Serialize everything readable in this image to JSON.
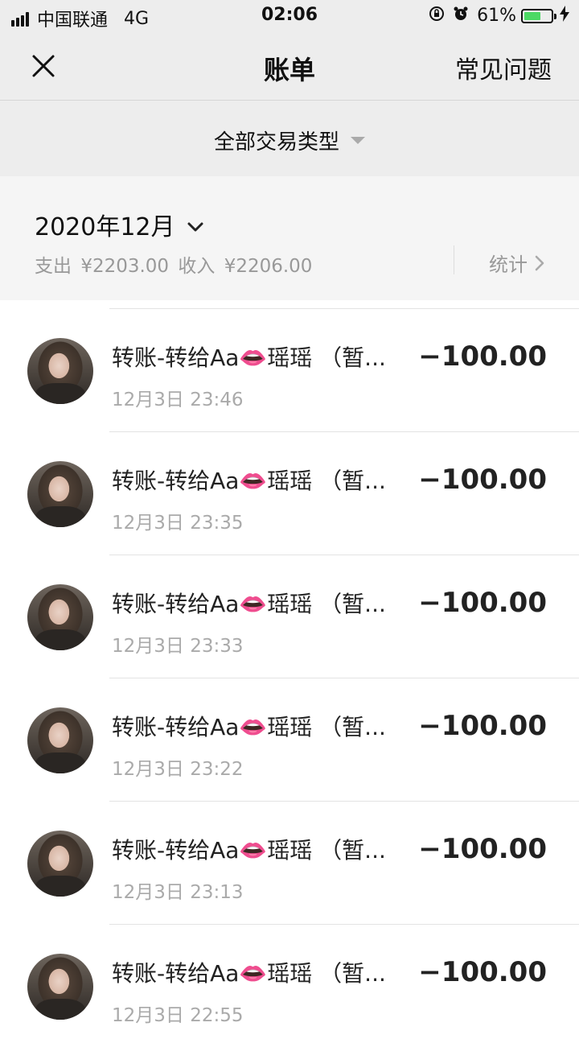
{
  "status_bar": {
    "carrier": "中国联通",
    "network": "4G",
    "time": "02:06",
    "battery": "61%",
    "battery_level": 0.61,
    "battery_color": "#4cd964"
  },
  "header": {
    "title": "账单",
    "faq_label": "常见问题",
    "close_icon": "close-icon"
  },
  "filter": {
    "label": "全部交易类型"
  },
  "summary": {
    "month": "2020年12月",
    "expense_label": "支出",
    "expense": "¥2203.00",
    "income_label": "收入",
    "income": "¥2206.00",
    "stats_label": "统计"
  },
  "transactions": [
    {
      "title": "转账-转给Aa👄瑶瑶 （暂...",
      "time": "12月3日 23:46",
      "amount": "−100.00"
    },
    {
      "title": "转账-转给Aa👄瑶瑶 （暂...",
      "time": "12月3日 23:35",
      "amount": "−100.00"
    },
    {
      "title": "转账-转给Aa👄瑶瑶 （暂...",
      "time": "12月3日 23:33",
      "amount": "−100.00"
    },
    {
      "title": "转账-转给Aa👄瑶瑶 （暂...",
      "time": "12月3日 23:22",
      "amount": "−100.00"
    },
    {
      "title": "转账-转给Aa👄瑶瑶 （暂...",
      "time": "12月3日 23:13",
      "amount": "−100.00"
    },
    {
      "title": "转账-转给Aa👄瑶瑶 （暂...",
      "time": "12月3日 22:55",
      "amount": "−100.00"
    }
  ]
}
